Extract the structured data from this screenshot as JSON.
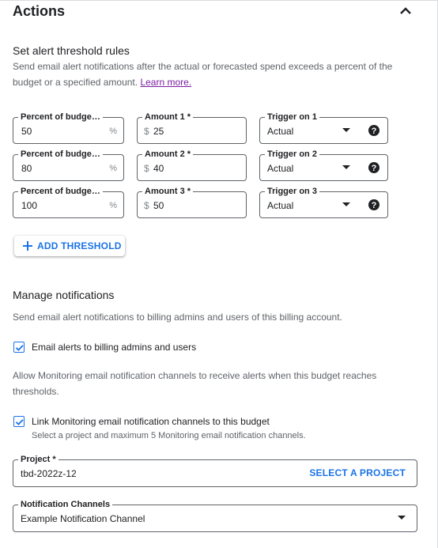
{
  "section": {
    "title": "Actions",
    "collapse_icon": "chevron-up-icon"
  },
  "threshold_rules": {
    "heading": "Set alert threshold rules",
    "description": "Send email alert notifications after the actual or forecasted spend exceeds a percent of the budget or a specified amount.",
    "learn_more": "Learn more.",
    "rows": [
      {
        "percent_label": "Percent of budge…",
        "percent_value": "50",
        "percent_suffix": "%",
        "amount_label": "Amount 1 *",
        "amount_prefix": "$",
        "amount_value": "25",
        "trigger_label": "Trigger on 1",
        "trigger_value": "Actual"
      },
      {
        "percent_label": "Percent of budge…",
        "percent_value": "80",
        "percent_suffix": "%",
        "amount_label": "Amount 2 *",
        "amount_prefix": "$",
        "amount_value": "40",
        "trigger_label": "Trigger on 2",
        "trigger_value": "Actual"
      },
      {
        "percent_label": "Percent of budge…",
        "percent_value": "100",
        "percent_suffix": "%",
        "amount_label": "Amount 3 *",
        "amount_prefix": "$",
        "amount_value": "50",
        "trigger_label": "Trigger on 3",
        "trigger_value": "Actual"
      }
    ],
    "add_threshold_label": "ADD THRESHOLD"
  },
  "notifications": {
    "heading": "Manage notifications",
    "description": "Send email alert notifications to billing admins and users of this billing account.",
    "email_alerts_label": "Email alerts to billing admins and users",
    "email_alerts_checked": true,
    "monitoring_description": "Allow Monitoring email notification channels to receive alerts when this budget reaches thresholds.",
    "link_monitoring_label": "Link Monitoring email notification channels to this budget",
    "link_monitoring_checked": true,
    "link_monitoring_sub": "Select a project and maximum 5 Monitoring email notification channels.",
    "project_label": "Project *",
    "project_value": "tbd-2022z-12",
    "select_project_label": "SELECT A PROJECT",
    "channels_label": "Notification Channels",
    "channels_value": "Example Notification Channel"
  },
  "colors": {
    "accent": "#1a73e8",
    "link_visited": "#7b1fa2",
    "text": "#202124",
    "secondary_text": "#5f6368"
  }
}
